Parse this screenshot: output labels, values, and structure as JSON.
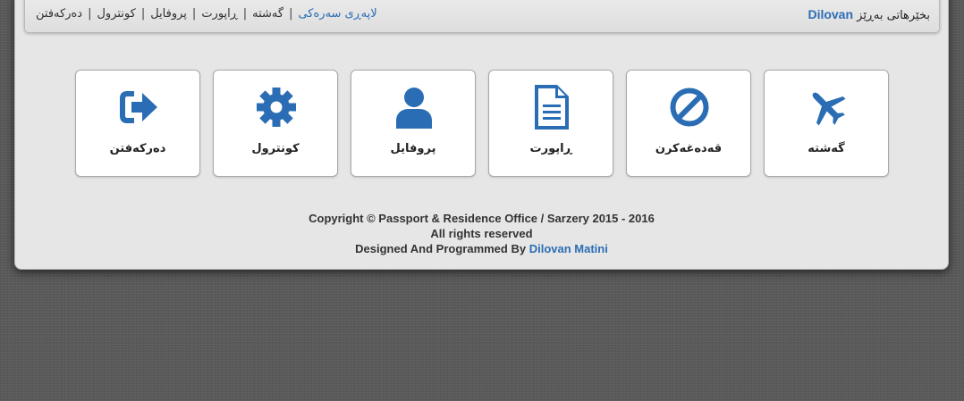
{
  "header": {
    "welcome_prefix": "بخێرهاتی بەڕێز",
    "username": "Dilovan",
    "nav": [
      {
        "label": "لاپەڕی سەرەکی",
        "active": true
      },
      {
        "label": "گەشتە",
        "active": false
      },
      {
        "label": "ڕاپورت",
        "active": false
      },
      {
        "label": "پروفایل",
        "active": false
      },
      {
        "label": "کونترول",
        "active": false
      },
      {
        "label": "دەرکەفتن",
        "active": false
      }
    ],
    "separator": "|"
  },
  "tiles": [
    {
      "label": "گەشتە",
      "icon": "plane-icon"
    },
    {
      "label": "قەدەغەکرن",
      "icon": "ban-icon"
    },
    {
      "label": "ڕاپورت",
      "icon": "document-icon"
    },
    {
      "label": "پروفایل",
      "icon": "user-icon"
    },
    {
      "label": "کونترول",
      "icon": "gear-icon"
    },
    {
      "label": "دەرکەفتن",
      "icon": "sign-out-icon"
    }
  ],
  "footer": {
    "copyright": "Copyright © Passport & Residence Office / Sarzery 2015 - 2016",
    "rights": "All rights reserved",
    "designed_by_prefix": "Designed And Programmed By",
    "author": "Dilovan Matini"
  },
  "colors": {
    "accent": "#2a6db5",
    "panel": "#e6e6e6",
    "background": "#5a5a5a"
  }
}
